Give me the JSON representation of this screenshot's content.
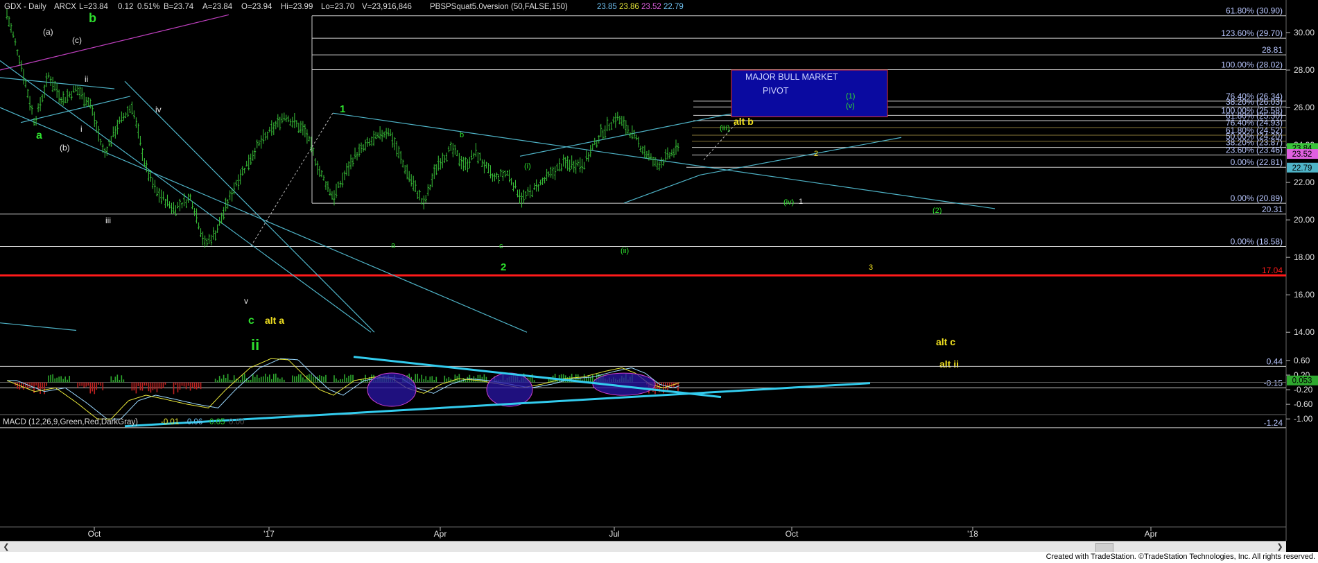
{
  "header": {
    "symbol": "GDX - Daily",
    "exchange": "ARCX",
    "last": "L=23.84",
    "change": "0.12",
    "change_pct": "0.51%",
    "bid": "B=23.74",
    "ask": "A=23.84",
    "open": "O=23.94",
    "high": "Hi=23.99",
    "low": "Lo=23.70",
    "volume": "V=23,916,846",
    "indicator": "PBSPSquat5.0version (50,FALSE,150)",
    "ind_values": [
      "23.85",
      "23.86",
      "23.52",
      "22.79"
    ],
    "ind_colors": [
      "#6fc0f0",
      "#e8e83a",
      "#e060e0",
      "#6fc0f0"
    ]
  },
  "macd_header": {
    "label": "MACD (12,26,9,Green,Red,DarkGray)",
    "values": [
      "-0.01",
      "-0.06",
      "0.05",
      "0.00"
    ],
    "colors": [
      "#e8e83a",
      "#6fc0f0",
      "#30d030",
      "#555555"
    ]
  },
  "footer": {
    "text": "Created with TradeStation. ©TradeStation Technologies, Inc. All rights reserved."
  },
  "colors": {
    "background": "#000000",
    "candles": "#39c339",
    "trend_lines": "#4fb4c8",
    "support_red": "#ff1a1a",
    "pivot_box": "#0a0aa0",
    "wave_green": "#2ee02e",
    "wave_yellow": "#f0e020",
    "macd_line": "#e8e83a",
    "signal_line": "#9ad8ff",
    "macd_trend": "#33ccee"
  },
  "chart_data": {
    "type": "candlestick",
    "y_range": [
      13.6,
      31.0
    ],
    "price_axis_ticks": [
      30,
      28,
      26,
      24,
      22,
      20,
      18,
      16,
      14
    ],
    "time_axis": [
      "Oct",
      "'17",
      "Apr",
      "Jul",
      "Oct",
      "'18",
      "Apr"
    ],
    "price_path_anchors": [
      [
        0,
        31.0
      ],
      [
        20,
        28.4
      ],
      [
        40,
        25.2
      ],
      [
        60,
        27.7
      ],
      [
        80,
        26.4
      ],
      [
        100,
        27.0
      ],
      [
        120,
        26.2
      ],
      [
        140,
        23.5
      ],
      [
        160,
        25.1
      ],
      [
        180,
        26.1
      ],
      [
        200,
        22.8
      ],
      [
        215,
        21.5
      ],
      [
        240,
        20.6
      ],
      [
        265,
        21.2
      ],
      [
        285,
        18.7
      ],
      [
        300,
        19.3
      ],
      [
        330,
        22.0
      ],
      [
        360,
        23.9
      ],
      [
        400,
        25.6
      ],
      [
        430,
        24.7
      ],
      [
        450,
        22.6
      ],
      [
        470,
        21.2
      ],
      [
        500,
        23.4
      ],
      [
        525,
        24.2
      ],
      [
        550,
        24.8
      ],
      [
        570,
        23.0
      ],
      [
        600,
        20.8
      ],
      [
        620,
        23.0
      ],
      [
        640,
        23.8
      ],
      [
        660,
        22.9
      ],
      [
        675,
        23.6
      ],
      [
        700,
        22.2
      ],
      [
        720,
        22.5
      ],
      [
        742,
        21.1
      ],
      [
        770,
        22.0
      ],
      [
        800,
        23.0
      ],
      [
        830,
        23.0
      ],
      [
        855,
        24.6
      ],
      [
        878,
        25.5
      ],
      [
        895,
        24.8
      ],
      [
        915,
        23.8
      ],
      [
        935,
        22.9
      ],
      [
        955,
        23.5
      ],
      [
        968,
        23.84
      ]
    ],
    "fib_levels": [
      {
        "label": "61.80% (30.90)",
        "price": 30.9
      },
      {
        "label": "123.60% (29.70)",
        "price": 29.7
      },
      {
        "label": "28.81",
        "price": 28.81
      },
      {
        "label": "100.00% (28.02)",
        "price": 28.02
      },
      {
        "label": "76.40% (26.34)",
        "price": 26.34
      },
      {
        "label": "38.20% (26.03)",
        "price": 26.03
      },
      {
        "label": "100.00% (25.58)",
        "price": 25.58
      },
      {
        "label": "61.80% (25.30)",
        "price": 25.3
      },
      {
        "label": "76.40% (24.93)",
        "price": 24.93
      },
      {
        "label": "61.80% (24.52)",
        "price": 24.52
      },
      {
        "label": "50.00% (24.20)",
        "price": 24.2
      },
      {
        "label": "38.20% (23.87)",
        "price": 23.87
      },
      {
        "label": "23.60% (23.46)",
        "price": 23.46
      },
      {
        "label": "0.00% (22.81)",
        "price": 22.81
      },
      {
        "label": "0.00% (20.89)",
        "price": 20.89
      },
      {
        "label": "20.31",
        "price": 20.31
      },
      {
        "label": "0.00% (18.58)",
        "price": 18.58
      },
      {
        "label": "17.04",
        "price": 17.04
      }
    ],
    "price_badges": [
      {
        "label": "23.84",
        "price": 23.84,
        "bg": "#39c339"
      },
      {
        "label": "23.52",
        "price": 23.52,
        "bg": "#e060e0"
      },
      {
        "label": "22.79",
        "price": 22.79,
        "bg": "#4fb4c8"
      }
    ],
    "pivot_box": {
      "title": "MAJOR BULL MARKET",
      "subtitle": "PIVOT",
      "top": 28.0,
      "bottom": 25.5
    },
    "wave_labels": [
      {
        "t": "b",
        "color": "green"
      },
      {
        "t": "a",
        "color": "green"
      },
      {
        "t": "1",
        "color": "green"
      },
      {
        "t": "2",
        "color": "green"
      },
      {
        "t": "c",
        "color": "green"
      },
      {
        "t": "ii",
        "color": "green"
      },
      {
        "t": "alt a",
        "color": "yellow"
      },
      {
        "t": "alt b",
        "color": "yellow"
      },
      {
        "t": "alt c",
        "color": "yellow"
      },
      {
        "t": "alt ii",
        "color": "yellow"
      },
      {
        "t": "(a)",
        "color": "white"
      },
      {
        "t": "(c)",
        "color": "white"
      },
      {
        "t": "(b)",
        "color": "white"
      },
      {
        "t": "ii",
        "color": "white"
      },
      {
        "t": "i",
        "color": "white"
      },
      {
        "t": "iv",
        "color": "white"
      },
      {
        "t": "iii",
        "color": "white"
      },
      {
        "t": "v",
        "color": "white"
      },
      {
        "t": "a",
        "color": "green"
      },
      {
        "t": "b",
        "color": "green"
      },
      {
        "t": "c",
        "color": "green"
      },
      {
        "t": "(i)",
        "color": "green"
      },
      {
        "t": "(ii)",
        "color": "green"
      },
      {
        "t": "(iii)",
        "color": "green"
      },
      {
        "t": "(iv)",
        "color": "green"
      },
      {
        "t": "1",
        "color": "white"
      },
      {
        "t": "2",
        "color": "yellow"
      },
      {
        "t": "3",
        "color": "yellow"
      },
      {
        "t": "(1)",
        "color": "green"
      },
      {
        "t": "(v)",
        "color": "green"
      },
      {
        "t": "(2)",
        "color": "green"
      }
    ],
    "macd": {
      "y_range": [
        -1.3,
        0.75
      ],
      "axis_ticks": [
        "0.60",
        "0.20",
        "-0.20",
        "-0.60",
        "-1.00"
      ],
      "axis_values": [
        0.6,
        0.2,
        -0.2,
        -0.6,
        -1.0
      ],
      "level_labels": [
        {
          "label": "0.44",
          "value": 0.44
        },
        {
          "label": "-0.15",
          "value": -0.15
        },
        {
          "label": "-1.24",
          "value": -1.24
        }
      ],
      "current_badge": {
        "label": "0.053",
        "value": 0.053
      },
      "macd_anchors": [
        [
          0,
          0.05
        ],
        [
          20,
          -0.1
        ],
        [
          40,
          -0.25
        ],
        [
          70,
          -0.15
        ],
        [
          100,
          -0.55
        ],
        [
          130,
          -1.0
        ],
        [
          150,
          -1.0
        ],
        [
          175,
          -0.5
        ],
        [
          200,
          -0.35
        ],
        [
          225,
          -0.45
        ],
        [
          260,
          -0.6
        ],
        [
          290,
          -0.7
        ],
        [
          315,
          -0.2
        ],
        [
          350,
          0.4
        ],
        [
          380,
          0.65
        ],
        [
          405,
          0.62
        ],
        [
          430,
          0.15
        ],
        [
          450,
          -0.2
        ],
        [
          470,
          -0.35
        ],
        [
          500,
          0.05
        ],
        [
          530,
          0.15
        ],
        [
          555,
          0.1
        ],
        [
          575,
          -0.15
        ],
        [
          600,
          -0.3
        ],
        [
          625,
          -0.05
        ],
        [
          650,
          0.1
        ],
        [
          680,
          0.05
        ],
        [
          710,
          -0.05
        ],
        [
          740,
          -0.15
        ],
        [
          770,
          -0.05
        ],
        [
          800,
          0.1
        ],
        [
          830,
          0.15
        ],
        [
          860,
          0.3
        ],
        [
          885,
          0.4
        ],
        [
          905,
          0.25
        ],
        [
          925,
          -0.05
        ],
        [
          945,
          -0.15
        ],
        [
          968,
          -0.01
        ]
      ],
      "hist_regions": [
        [
          10,
          60,
          -1
        ],
        [
          60,
          90,
          1
        ],
        [
          100,
          140,
          -1
        ],
        [
          150,
          170,
          1
        ],
        [
          180,
          230,
          -1
        ],
        [
          240,
          280,
          -1
        ],
        [
          300,
          400,
          1
        ],
        [
          410,
          460,
          1
        ],
        [
          470,
          500,
          1
        ],
        [
          510,
          560,
          1
        ],
        [
          570,
          620,
          1
        ],
        [
          630,
          690,
          1
        ],
        [
          700,
          760,
          1
        ],
        [
          780,
          900,
          1
        ],
        [
          920,
          968,
          -1
        ]
      ]
    }
  }
}
